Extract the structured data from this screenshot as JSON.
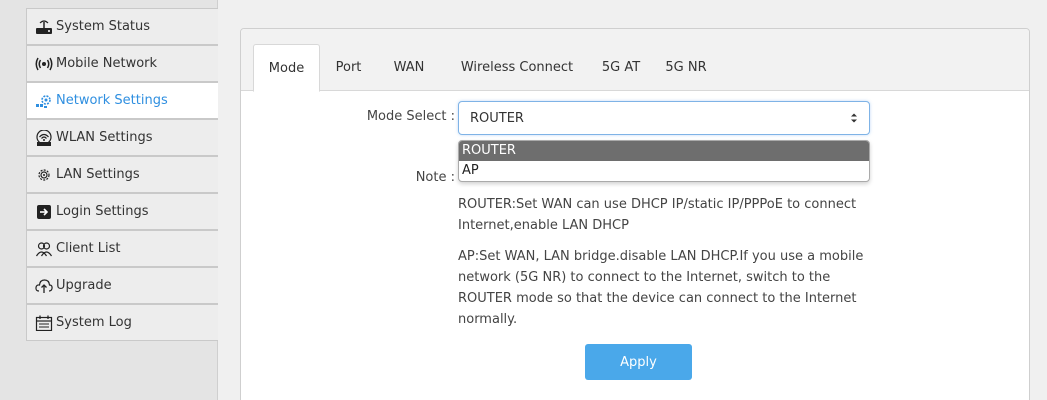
{
  "sidebar": {
    "items": [
      {
        "label": "System Status",
        "icon": "router-icon"
      },
      {
        "label": "Mobile Network",
        "icon": "signal-icon"
      },
      {
        "label": "Network Settings",
        "icon": "network-settings-icon",
        "active": true
      },
      {
        "label": "WLAN Settings",
        "icon": "wifi-icon"
      },
      {
        "label": "LAN Settings",
        "icon": "gear-icon"
      },
      {
        "label": "Login Settings",
        "icon": "login-icon"
      },
      {
        "label": "Client List",
        "icon": "users-icon"
      },
      {
        "label": "Upgrade",
        "icon": "upload-cloud-icon"
      },
      {
        "label": "System Log",
        "icon": "calendar-log-icon"
      }
    ]
  },
  "tabs": [
    "Mode",
    "Port",
    "WAN",
    "Wireless Connect",
    "5G AT",
    "5G NR"
  ],
  "active_tab": "Mode",
  "mode": {
    "select_label": "Mode Select :",
    "selected_value": "ROUTER",
    "options": [
      "ROUTER",
      "AP"
    ],
    "note_label": "Note :",
    "note_router": "ROUTER:Set WAN can use DHCP IP/static IP/PPPoE to connect Internet,enable LAN DHCP",
    "note_ap": "AP:Set WAN, LAN bridge.disable LAN DHCP.If you use a mobile network (5G NR) to connect to the Internet, switch to the ROUTER mode so that the device can connect to the Internet normally.",
    "apply_label": "Apply"
  },
  "colors": {
    "accent": "#2f8fe0",
    "button": "#4aa8ea",
    "selected_option": "#6e6e6e"
  }
}
